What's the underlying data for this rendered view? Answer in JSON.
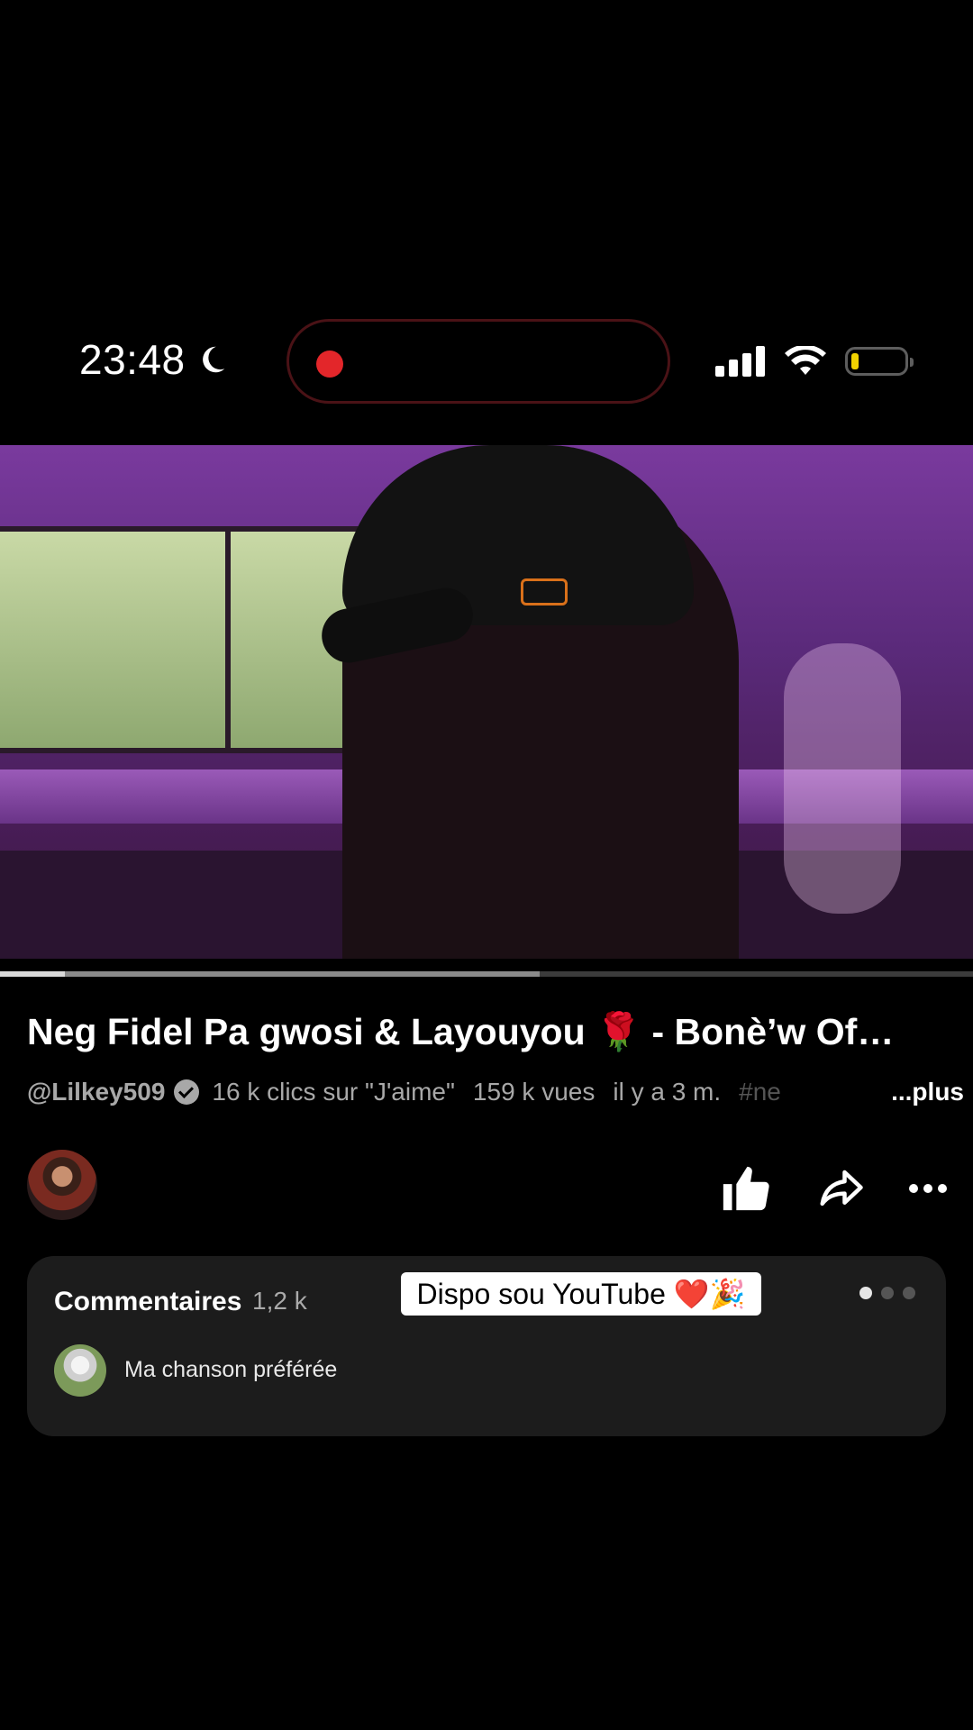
{
  "status_bar": {
    "time": "23:48",
    "icons": [
      "moon-icon",
      "recording-dot-icon",
      "signal-icon",
      "wifi-icon",
      "battery-icon"
    ]
  },
  "player": {
    "progress_played": 0.067,
    "progress_buffered": 0.555
  },
  "video": {
    "title": "Neg Fidel Pa gwosi & Layouyou 🌹 - Bonè’w Of…",
    "channel": "@Lilkey509",
    "likes": "16 k clics sur \"J'aime\"",
    "views": "159 k vues",
    "age": "il y a 3 m.",
    "hashtag": "#ne",
    "more": "...plus"
  },
  "actions": {
    "icons": [
      "thumbs-up-icon",
      "share-icon",
      "more-icon"
    ]
  },
  "comments": {
    "label": "Commentaires",
    "count": "1,2 k",
    "sticker": "Dispo sou YouTube ❤️🎉",
    "top_comment": "Ma chanson préférée"
  },
  "colors": {
    "record": "#e3262a",
    "battery_low": "#f1d300",
    "card_bg": "#1c1c1c"
  }
}
